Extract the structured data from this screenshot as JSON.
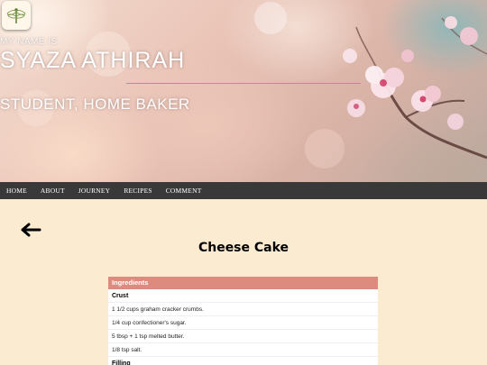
{
  "hero": {
    "pre_title": "MY NAME IS",
    "title": "SYAZA ATHIRAH",
    "subtitle": "STUDENT, HOME BAKER"
  },
  "logo": {
    "icon": "dragonfly-icon"
  },
  "nav": {
    "items": [
      {
        "label": "HOME"
      },
      {
        "label": "ABOUT"
      },
      {
        "label": "JOURNEY"
      },
      {
        "label": "RECIPES"
      },
      {
        "label": "COMMENT"
      }
    ]
  },
  "main": {
    "back_icon": "back-arrow-icon",
    "title": "Cheese Cake"
  },
  "recipe": {
    "header": "Ingredients",
    "rows": [
      {
        "text": "Crust",
        "section": true
      },
      {
        "text": "1 1/2 cups graham cracker crumbs."
      },
      {
        "text": "1/4 cup confectioner's sugar."
      },
      {
        "text": "5 tbsp + 1 tsp melted butter."
      },
      {
        "text": "1/8 tsp salt."
      },
      {
        "text": "Filling",
        "section": true
      }
    ]
  },
  "colors": {
    "background": "#fbebd0",
    "nav_bg": "#393939",
    "recipe_header": "#dd8b7e"
  }
}
